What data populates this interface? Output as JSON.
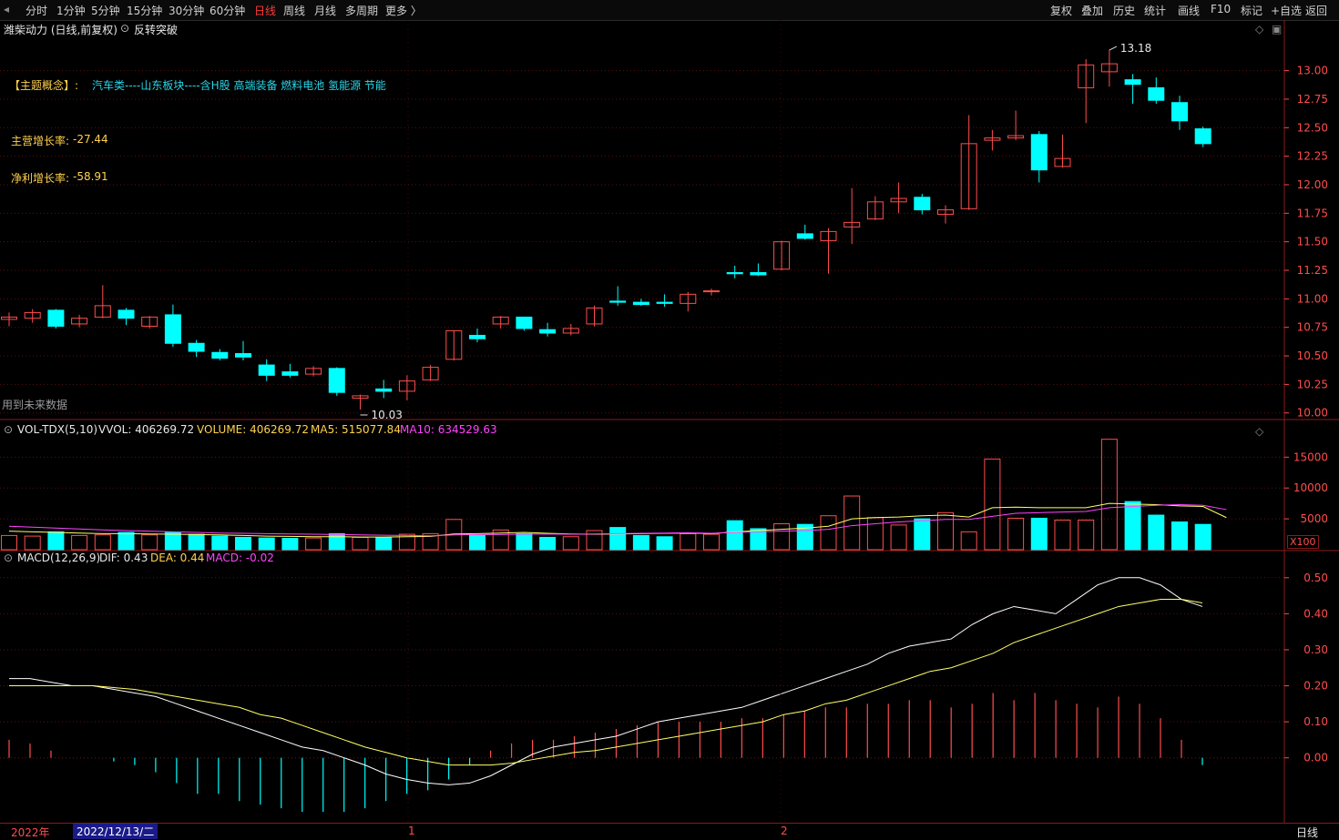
{
  "toolbar": {
    "periods": [
      "分时",
      "1分钟",
      "5分钟",
      "15分钟",
      "30分钟",
      "60分钟",
      "日线",
      "周线",
      "月线",
      "多周期",
      "更多 〉"
    ],
    "active_period": "日线",
    "right_tools": [
      "复权",
      "叠加",
      "历史",
      "统计",
      "画线",
      "F10",
      "标记",
      "+自选",
      "返回"
    ]
  },
  "price_panel": {
    "title": "潍柴动力 (日线,前复权)",
    "indicator": "反转突破",
    "theme_label": "【主题概念】:",
    "theme_value": "汽车类----山东板块----含H股 高端装备 燃料电池 氢能源 节能",
    "revenue_growth_label": "主营增长率:",
    "revenue_growth_value": "-27.44",
    "profit_growth_label": "净利增长率:",
    "profit_growth_value": "-58.91",
    "future_data_note": "用到未来数据",
    "high_marker": "13.18",
    "low_marker": "10.03"
  },
  "volume_panel": {
    "header": {
      "name": "VOL-TDX(5,10)",
      "vvol": "VVOL: 406269.72",
      "volume": "VOLUME: 406269.72",
      "ma5": "MA5: 515077.84",
      "ma10": "MA10: 634529.63"
    },
    "unit_badge": "X100"
  },
  "macd_panel": {
    "header": {
      "name": "MACD(12,26,9)",
      "dif": "DIF: 0.43",
      "dea": "DEA: 0.44",
      "macd": "MACD: -0.02"
    }
  },
  "bottom": {
    "year_label": "2022年",
    "cursor_date": "2022/12/13/二",
    "month_1": "1",
    "month_2": "2",
    "period_label": "日线"
  },
  "colors": {
    "up": "#ff4d4d",
    "down": "#00ffff",
    "dif_line": "#ffffff",
    "dea_line": "#ffff66",
    "ma10": "#ff44ff",
    "gold_text": "#ffd24d",
    "cyan_text": "#2ad4e6"
  },
  "chart_data": {
    "type": "candlestick",
    "price_axis_ticks": [
      "13.00",
      "12.75",
      "12.50",
      "12.25",
      "12.00",
      "11.75",
      "11.50",
      "11.25",
      "11.00",
      "10.75",
      "10.50",
      "10.25",
      "10.00"
    ],
    "volume_axis_ticks": [
      "15000",
      "10000",
      "5000"
    ],
    "macd_axis_ticks": [
      "0.50",
      "0.40",
      "0.30",
      "0.20",
      "0.10",
      "0.00"
    ],
    "candles": [
      {
        "o": 10.82,
        "h": 10.88,
        "l": 10.76,
        "c": 10.84
      },
      {
        "o": 10.83,
        "h": 10.91,
        "l": 10.79,
        "c": 10.88
      },
      {
        "o": 10.9,
        "h": 10.91,
        "l": 10.74,
        "c": 10.76
      },
      {
        "o": 10.78,
        "h": 10.86,
        "l": 10.75,
        "c": 10.83
      },
      {
        "o": 10.84,
        "h": 11.12,
        "l": 10.83,
        "c": 10.94
      },
      {
        "o": 10.9,
        "h": 10.92,
        "l": 10.77,
        "c": 10.83
      },
      {
        "o": 10.76,
        "h": 10.85,
        "l": 10.74,
        "c": 10.84
      },
      {
        "o": 10.86,
        "h": 10.95,
        "l": 10.58,
        "c": 10.61
      },
      {
        "o": 10.61,
        "h": 10.64,
        "l": 10.49,
        "c": 10.54
      },
      {
        "o": 10.53,
        "h": 10.56,
        "l": 10.46,
        "c": 10.48
      },
      {
        "o": 10.52,
        "h": 10.63,
        "l": 10.46,
        "c": 10.49
      },
      {
        "o": 10.42,
        "h": 10.47,
        "l": 10.28,
        "c": 10.33
      },
      {
        "o": 10.36,
        "h": 10.43,
        "l": 10.31,
        "c": 10.33
      },
      {
        "o": 10.34,
        "h": 10.41,
        "l": 10.32,
        "c": 10.39
      },
      {
        "o": 10.39,
        "h": 10.4,
        "l": 10.15,
        "c": 10.18
      },
      {
        "o": 10.13,
        "h": 10.16,
        "l": 10.03,
        "c": 10.15
      },
      {
        "o": 10.21,
        "h": 10.29,
        "l": 10.13,
        "c": 10.19
      },
      {
        "o": 10.19,
        "h": 10.33,
        "l": 10.11,
        "c": 10.28
      },
      {
        "o": 10.29,
        "h": 10.42,
        "l": 10.28,
        "c": 10.4
      },
      {
        "o": 10.47,
        "h": 10.72,
        "l": 10.46,
        "c": 10.72
      },
      {
        "o": 10.68,
        "h": 10.74,
        "l": 10.62,
        "c": 10.65
      },
      {
        "o": 10.78,
        "h": 10.85,
        "l": 10.74,
        "c": 10.84
      },
      {
        "o": 10.84,
        "h": 10.84,
        "l": 10.72,
        "c": 10.74
      },
      {
        "o": 10.73,
        "h": 10.79,
        "l": 10.67,
        "c": 10.7
      },
      {
        "o": 10.7,
        "h": 10.78,
        "l": 10.68,
        "c": 10.74
      },
      {
        "o": 10.78,
        "h": 10.94,
        "l": 10.76,
        "c": 10.92
      },
      {
        "o": 10.98,
        "h": 11.11,
        "l": 10.94,
        "c": 10.97
      },
      {
        "o": 10.97,
        "h": 11.0,
        "l": 10.94,
        "c": 10.95
      },
      {
        "o": 10.97,
        "h": 11.04,
        "l": 10.93,
        "c": 10.96
      },
      {
        "o": 10.96,
        "h": 11.06,
        "l": 10.89,
        "c": 11.04
      },
      {
        "o": 11.07,
        "h": 11.09,
        "l": 11.03,
        "c": 11.07
      },
      {
        "o": 11.23,
        "h": 11.29,
        "l": 11.18,
        "c": 11.22
      },
      {
        "o": 11.23,
        "h": 11.31,
        "l": 11.2,
        "c": 11.21
      },
      {
        "o": 11.26,
        "h": 11.51,
        "l": 11.25,
        "c": 11.5
      },
      {
        "o": 11.57,
        "h": 11.65,
        "l": 11.52,
        "c": 11.53
      },
      {
        "o": 11.51,
        "h": 11.62,
        "l": 11.22,
        "c": 11.59
      },
      {
        "o": 11.63,
        "h": 11.97,
        "l": 11.48,
        "c": 11.67
      },
      {
        "o": 11.7,
        "h": 11.9,
        "l": 11.69,
        "c": 11.85
      },
      {
        "o": 11.85,
        "h": 12.02,
        "l": 11.75,
        "c": 11.88
      },
      {
        "o": 11.89,
        "h": 11.92,
        "l": 11.74,
        "c": 11.78
      },
      {
        "o": 11.74,
        "h": 11.82,
        "l": 11.66,
        "c": 11.78
      },
      {
        "o": 11.79,
        "h": 12.61,
        "l": 11.78,
        "c": 12.36
      },
      {
        "o": 12.39,
        "h": 12.48,
        "l": 12.3,
        "c": 12.41
      },
      {
        "o": 12.41,
        "h": 12.65,
        "l": 12.39,
        "c": 12.43
      },
      {
        "o": 12.44,
        "h": 12.47,
        "l": 12.02,
        "c": 12.13
      },
      {
        "o": 12.16,
        "h": 12.44,
        "l": 12.15,
        "c": 12.23
      },
      {
        "o": 12.85,
        "h": 13.1,
        "l": 12.54,
        "c": 13.05
      },
      {
        "o": 12.99,
        "h": 13.18,
        "l": 12.86,
        "c": 13.06
      },
      {
        "o": 12.92,
        "h": 12.97,
        "l": 12.71,
        "c": 12.88
      },
      {
        "o": 12.85,
        "h": 12.94,
        "l": 12.71,
        "c": 12.74
      },
      {
        "o": 12.72,
        "h": 12.78,
        "l": 12.48,
        "c": 12.56
      },
      {
        "o": 12.49,
        "h": 12.51,
        "l": 12.33,
        "c": 12.36
      }
    ],
    "volume": [
      2300,
      2200,
      2900,
      2300,
      2400,
      2800,
      2400,
      2800,
      2500,
      2200,
      2000,
      1900,
      1850,
      1900,
      2600,
      2000,
      1950,
      2500,
      2600,
      4900,
      2300,
      3200,
      2600,
      2000,
      2100,
      3100,
      3600,
      2300,
      2100,
      2600,
      2500,
      4700,
      3400,
      4200,
      4100,
      5500,
      8700,
      5200,
      4000,
      5000,
      6000,
      2900,
      14700,
      5100,
      5100,
      4800,
      4800,
      17900,
      7800,
      5600,
      4500,
      4100,
      4100
    ],
    "vol_ma5": [
      3000,
      2900,
      2800,
      2700,
      2600,
      2600,
      2550,
      2500,
      2450,
      2400,
      2300,
      2200,
      2150,
      2100,
      2100,
      2050,
      2050,
      2100,
      2150,
      2550,
      2600,
      2700,
      2800,
      2650,
      2550,
      2500,
      2550,
      2600,
      2650,
      2700,
      2600,
      2900,
      3100,
      3300,
      3500,
      3800,
      5000,
      5200,
      5300,
      5500,
      5600,
      5300,
      6800,
      6900,
      6800,
      6800,
      6800,
      7500,
      7400,
      7300,
      7100,
      7000,
      5200
    ],
    "vol_ma10": [
      3800,
      3650,
      3500,
      3350,
      3200,
      3100,
      3000,
      2900,
      2800,
      2700,
      2650,
      2600,
      2550,
      2500,
      2450,
      2400,
      2350,
      2300,
      2250,
      2400,
      2450,
      2450,
      2500,
      2550,
      2500,
      2550,
      2600,
      2650,
      2700,
      2750,
      2650,
      2800,
      2900,
      3000,
      3100,
      3300,
      3900,
      4200,
      4500,
      4700,
      4900,
      4900,
      5400,
      5900,
      6000,
      6100,
      6200,
      6800,
      7000,
      7200,
      7300,
      7200,
      6500
    ],
    "dif": [
      0.22,
      0.22,
      0.21,
      0.2,
      0.2,
      0.19,
      0.18,
      0.17,
      0.15,
      0.13,
      0.11,
      0.09,
      0.07,
      0.05,
      0.03,
      0.02,
      0.0,
      -0.02,
      -0.045,
      -0.06,
      -0.07,
      -0.075,
      -0.07,
      -0.05,
      -0.02,
      0.01,
      0.03,
      0.04,
      0.05,
      0.06,
      0.08,
      0.1,
      0.11,
      0.12,
      0.13,
      0.14,
      0.16,
      0.18,
      0.2,
      0.22,
      0.24,
      0.26,
      0.29,
      0.31,
      0.32,
      0.33,
      0.37,
      0.4,
      0.42,
      0.41,
      0.4,
      0.44,
      0.48,
      0.5,
      0.5,
      0.48,
      0.44,
      0.42
    ],
    "dea": [
      0.2,
      0.2,
      0.2,
      0.2,
      0.2,
      0.195,
      0.19,
      0.18,
      0.17,
      0.16,
      0.15,
      0.14,
      0.12,
      0.11,
      0.09,
      0.07,
      0.05,
      0.03,
      0.015,
      0.0,
      -0.01,
      -0.02,
      -0.02,
      -0.02,
      -0.015,
      -0.005,
      0.005,
      0.015,
      0.02,
      0.03,
      0.04,
      0.05,
      0.06,
      0.07,
      0.08,
      0.09,
      0.1,
      0.12,
      0.13,
      0.15,
      0.16,
      0.18,
      0.2,
      0.22,
      0.24,
      0.25,
      0.27,
      0.29,
      0.32,
      0.34,
      0.36,
      0.38,
      0.4,
      0.42,
      0.43,
      0.44,
      0.44,
      0.43
    ],
    "macd_hist": [
      0.05,
      0.04,
      0.02,
      0.0,
      0.0,
      -0.01,
      -0.02,
      -0.04,
      -0.07,
      -0.1,
      -0.1,
      -0.12,
      -0.13,
      -0.14,
      -0.15,
      -0.15,
      -0.15,
      -0.14,
      -0.12,
      -0.1,
      -0.09,
      -0.06,
      -0.02,
      0.02,
      0.04,
      0.05,
      0.05,
      0.06,
      0.07,
      0.08,
      0.09,
      0.1,
      0.1,
      0.1,
      0.1,
      0.11,
      0.11,
      0.12,
      0.13,
      0.14,
      0.14,
      0.15,
      0.15,
      0.16,
      0.16,
      0.14,
      0.15,
      0.18,
      0.16,
      0.18,
      0.16,
      0.15,
      0.14,
      0.17,
      0.15,
      0.11,
      0.05,
      -0.02
    ],
    "ylim_price": [
      9.95,
      13.3
    ],
    "ylim_volume": [
      0,
      18000
    ],
    "ylim_macd": [
      -0.17,
      0.55
    ]
  }
}
